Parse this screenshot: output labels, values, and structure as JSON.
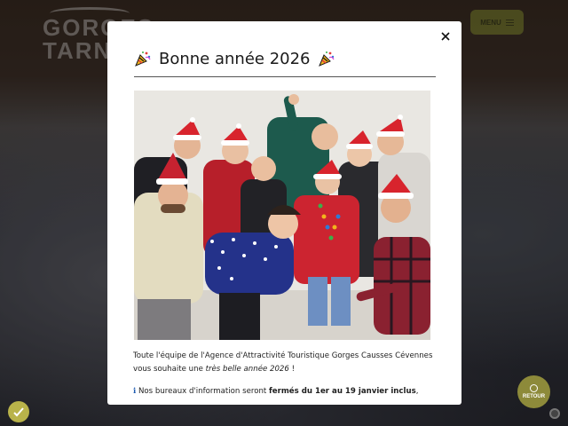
{
  "background": {
    "logo": {
      "line1": "GORGES",
      "line2": "TARN"
    },
    "menu_label": "MENU",
    "retour_label": "RETOUR"
  },
  "modal": {
    "title": "Bonne année 2026",
    "title_icon": "party-popper-icon",
    "close_icon": "close-icon",
    "photo_alt": "Toute l'équipe de l'Agence d'Attractivité Touristique Gorges Causses Cévennes avec des bonnets de Noël",
    "paragraph1": {
      "before": "Toute l'équipe de l'Agence d'Attractivité Touristique Gorges Causses Cévennes vous souhaite une ",
      "emphasis": "très belle année 2026",
      "after": " !"
    },
    "paragraph2": {
      "icon": "ℹ",
      "before": " Nos bureaux d'information seront ",
      "bold": "fermés du 1er au 19 janvier inclus",
      "after": ","
    }
  },
  "colors": {
    "accent": "#8d8a3a",
    "accent_light": "#b9b34a",
    "info": "#1e5bb0"
  }
}
